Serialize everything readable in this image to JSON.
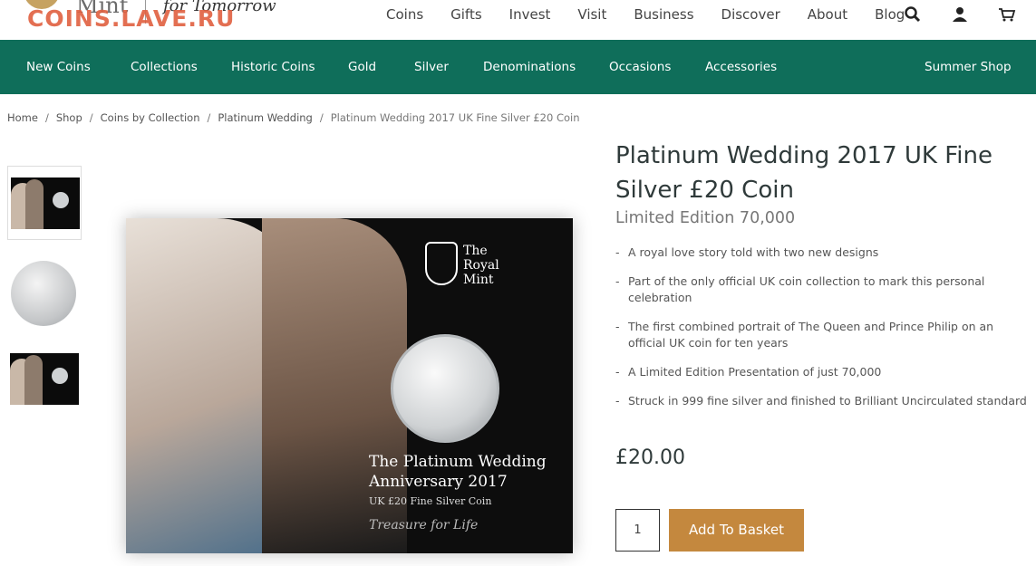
{
  "header": {
    "logo_text": "Mint",
    "tagline": "for Tomorrow",
    "watermark": "COINS.LAVE.RU",
    "nav": [
      "Coins",
      "Gifts",
      "Invest",
      "Visit",
      "Business",
      "Discover",
      "About",
      "Blog"
    ],
    "icons": [
      "search-icon",
      "user-icon",
      "basket-icon"
    ]
  },
  "categories": [
    "New Coins",
    "Collections",
    "Historic Coins",
    "Gold",
    "Silver",
    "Denominations",
    "Occasions",
    "Accessories",
    "Summer Shop"
  ],
  "breadcrumb": [
    "Home",
    "Shop",
    "Coins by Collection",
    "Platinum Wedding",
    "Platinum Wedding 2017 UK Fine Silver £20 Coin"
  ],
  "product": {
    "title": "Platinum Wedding 2017 UK Fine Silver £20 Coin",
    "edition": "Limited Edition 70,000",
    "bullets": [
      "A royal love story told with two new designs",
      "Part of the only official UK coin collection to mark this personal celebration",
      "The first combined portrait of The Queen and Prince Philip on an official UK coin for ten years",
      "A Limited Edition Presentation of just 70,000",
      "Struck in 999 fine silver and finished to Brilliant Uncirculated standard"
    ],
    "price": "£20.00",
    "quantity": "1",
    "add_button": "Add To Basket"
  },
  "image": {
    "brand_line1": "The",
    "brand_line2": "Royal",
    "brand_line3": "Mint",
    "title_line1": "The Platinum Wedding",
    "title_line2": "Anniversary 2017",
    "subtitle": "UK £20 Fine Silver Coin",
    "tagline": "Treasure for Life"
  },
  "colors": {
    "category_bar": "#0f6e5a",
    "button": "#c4883e"
  }
}
